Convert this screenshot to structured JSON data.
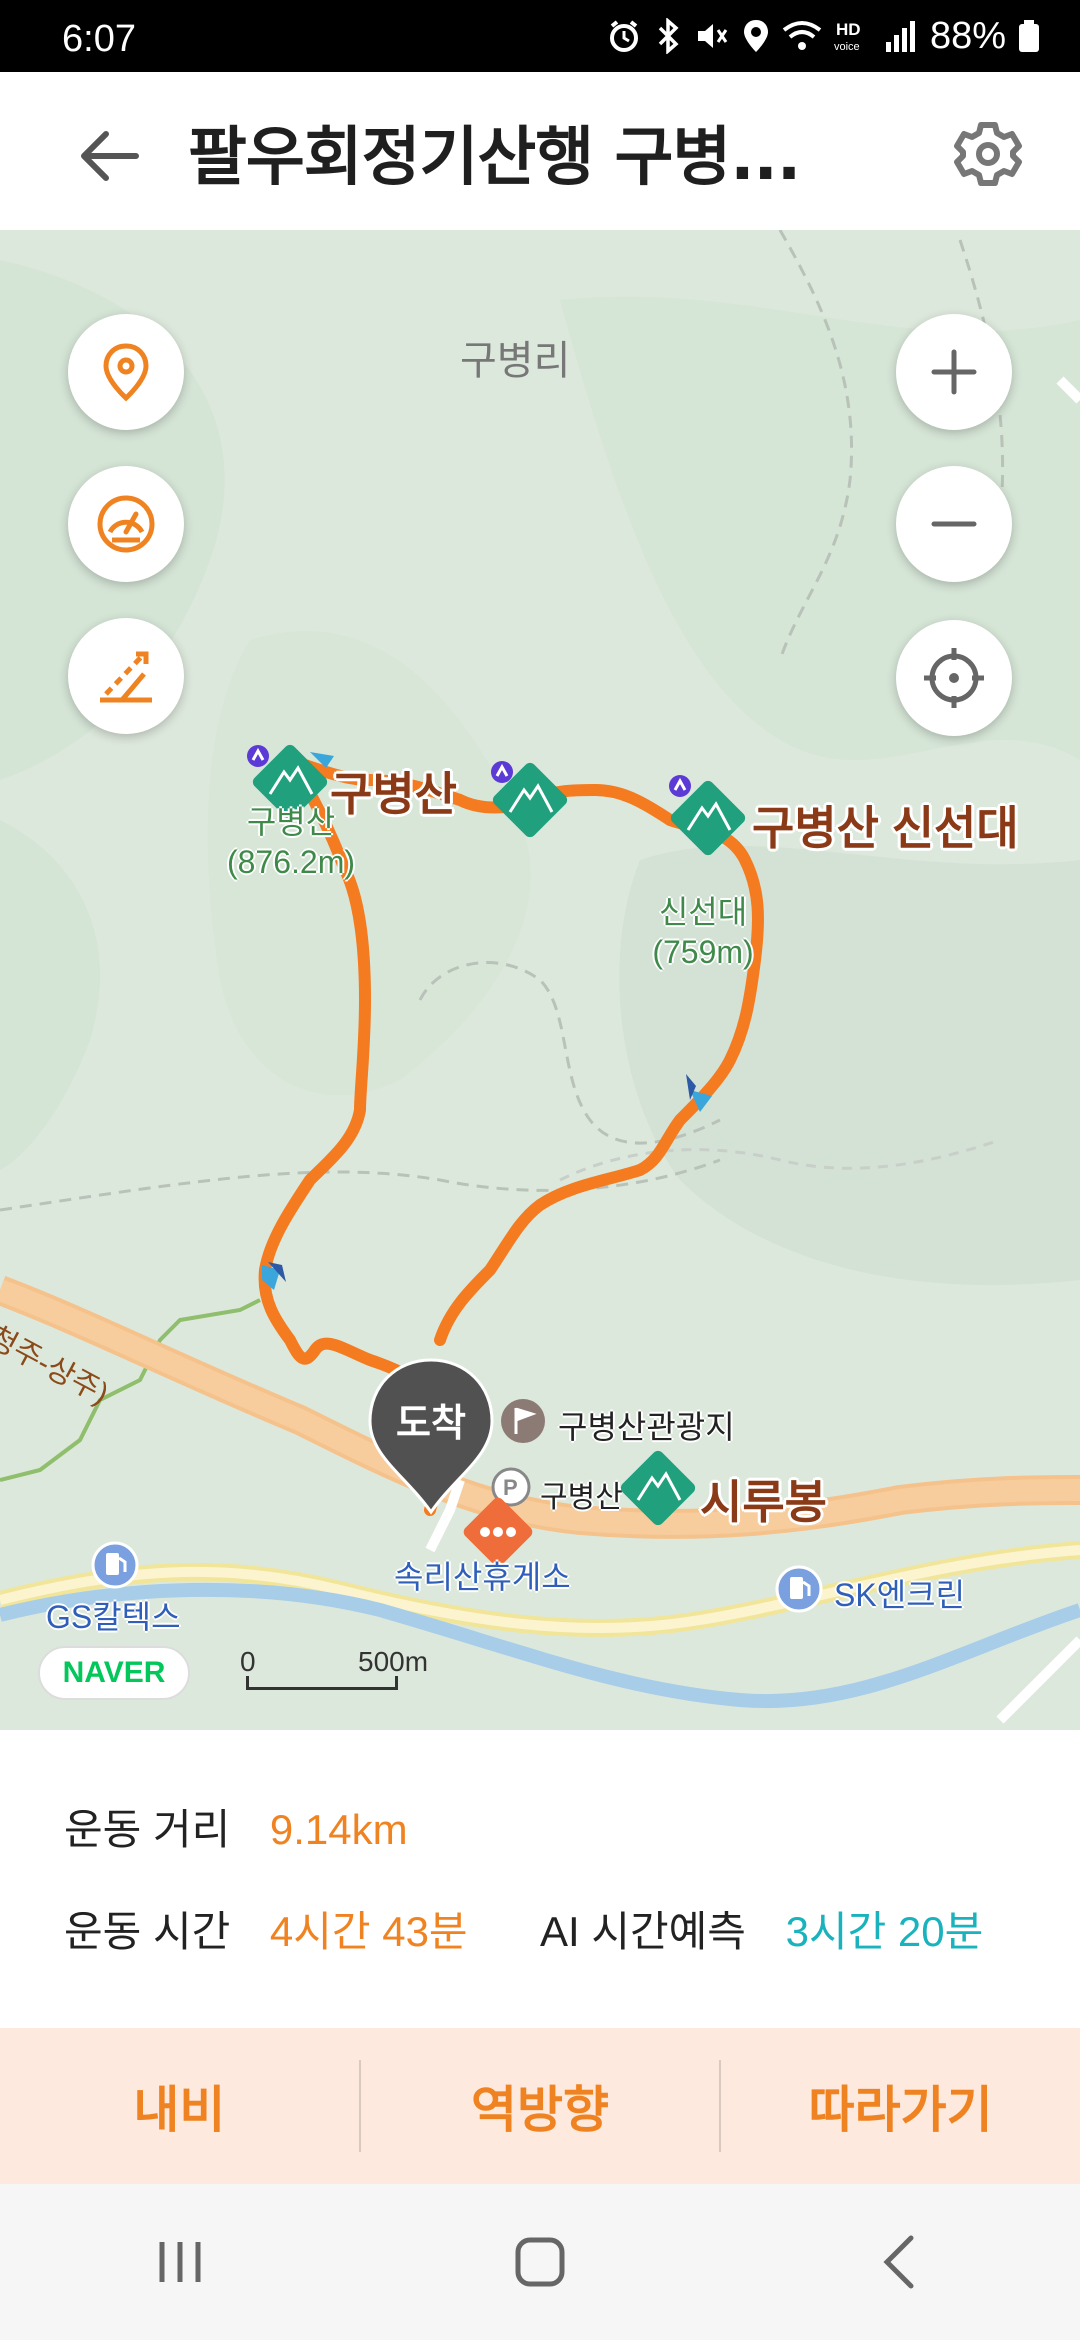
{
  "status_bar": {
    "time": "6:07",
    "battery_percent": "88%",
    "icons": [
      "alarm-icon",
      "bluetooth-icon",
      "mute-icon",
      "location-icon",
      "wifi-icon",
      "hd-voice-icon",
      "signal-icon",
      "battery-icon"
    ]
  },
  "header": {
    "title": "팔우회정기산행 구병...",
    "back_icon": "arrow-left-icon",
    "settings_icon": "gear-icon"
  },
  "map": {
    "village_label": "구병리",
    "peaks": [
      {
        "name": "구병산",
        "elevation_name": "구병산",
        "elevation": "(876.2m)"
      },
      {
        "name": "구병산 신선대",
        "elevation_name": "신선대",
        "elevation": "(759m)"
      },
      {
        "name": "시루봉"
      }
    ],
    "places": {
      "tourist_site": "구병산관광지",
      "rest_area": "속리산휴게소",
      "gas_station_1": "GS칼텍스",
      "gas_station_2": "SK엔크린",
      "partial_label": "구병산"
    },
    "road_label": "(청주-상주)",
    "arrival_label": "도착",
    "naver_logo": "NAVER",
    "scale": {
      "zero": "0",
      "distance": "500m"
    },
    "route_color": "#f47b20",
    "controls": {
      "left": [
        "pin-icon",
        "speedometer-icon",
        "slope-icon"
      ],
      "right": [
        "plus-icon",
        "minus-icon",
        "crosshair-icon"
      ]
    }
  },
  "stats": {
    "distance_label": "운동 거리",
    "distance_value": "9.14km",
    "time_label": "운동 시간",
    "time_value": "4시간 43분",
    "ai_label": "AI 시간예측",
    "ai_value": "3시간 20분"
  },
  "actions": [
    "내비",
    "역방향",
    "따라가기"
  ],
  "nav_bar": [
    "recent-apps-icon",
    "home-icon",
    "back-icon"
  ],
  "colors": {
    "accent": "#f08321",
    "teal": "#1ab3bd",
    "action_bg": "#fde9de"
  }
}
